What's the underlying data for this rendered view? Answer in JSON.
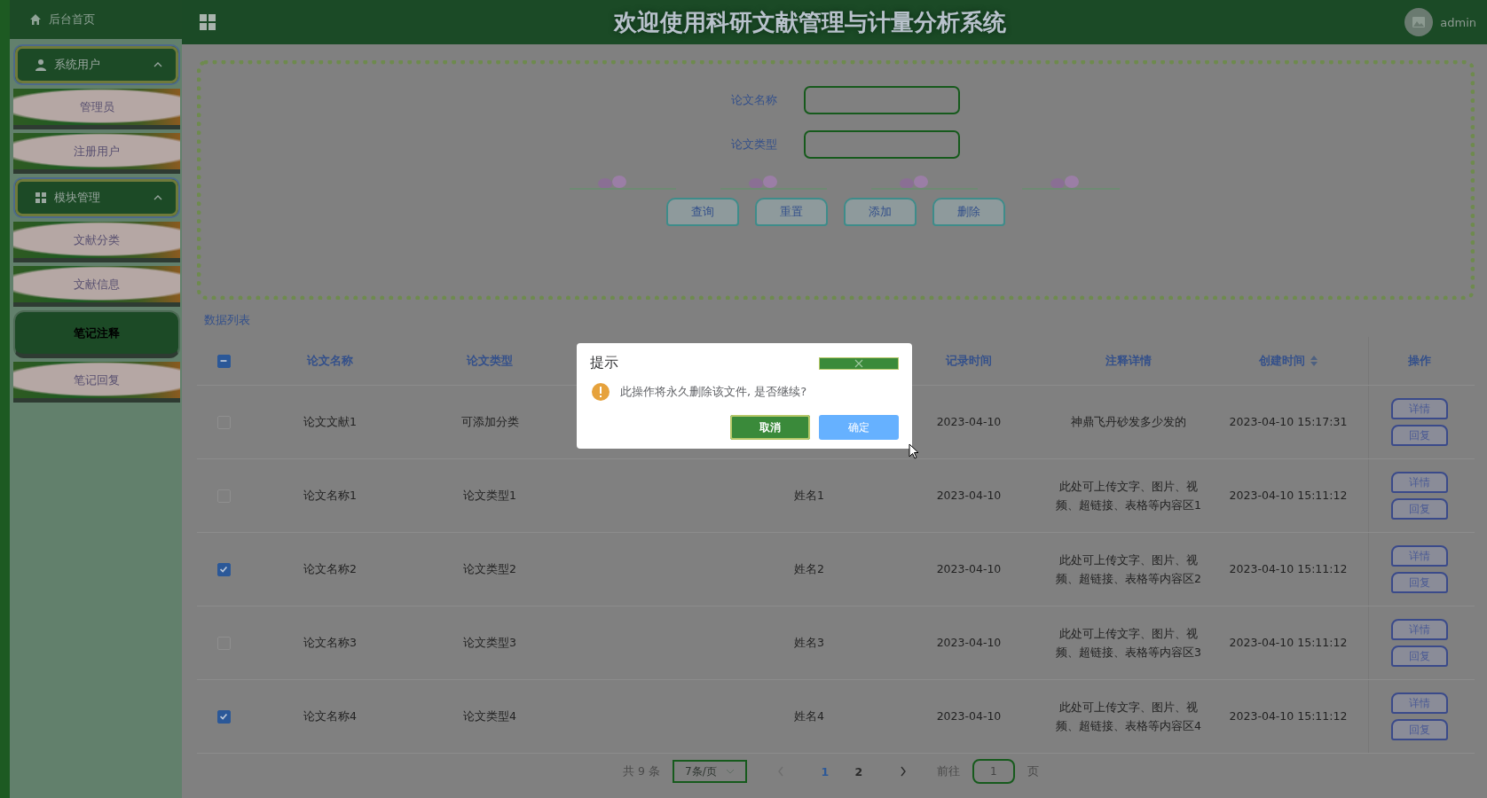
{
  "header": {
    "home": "后台首页",
    "title": "欢迎使用科研文献管理与计量分析系统",
    "user": "admin"
  },
  "sidebar": {
    "groups": [
      {
        "label": "系统用户",
        "expanded": true,
        "items": [
          {
            "label": "管理员",
            "selected": false
          },
          {
            "label": "注册用户",
            "selected": false
          }
        ]
      },
      {
        "label": "模块管理",
        "expanded": true,
        "items": [
          {
            "label": "文献分类",
            "selected": false
          },
          {
            "label": "文献信息",
            "selected": false
          },
          {
            "label": "笔记注释",
            "selected": true
          },
          {
            "label": "笔记回复",
            "selected": false
          }
        ]
      }
    ]
  },
  "search": {
    "fields": [
      {
        "label": "论文名称"
      },
      {
        "label": "论文类型"
      }
    ],
    "buttons": [
      "查询",
      "重置",
      "添加",
      "删除"
    ]
  },
  "list_title": "数据列表",
  "table": {
    "select_all": {
      "partial": true
    },
    "columns": [
      {
        "label": "论文名称"
      },
      {
        "label": "论文类型"
      },
      {},
      {},
      {
        "label": "记录时间"
      },
      {
        "label": "注释详情"
      },
      {
        "label": "创建时间",
        "sortable": true
      }
    ],
    "actions_label": "操作",
    "rows": [
      {
        "checked": false,
        "title": "论文文献1",
        "type": "可添加分类",
        "record_date": "2023-04-10",
        "detail": "神鼎飞丹砂发多少发的",
        "created": "2023-04-10 15:17:31",
        "actions": [
          "详情",
          "回复"
        ]
      },
      {
        "checked": false,
        "title": "论文名称1",
        "type": "论文类型1",
        "column_4": "姓名1",
        "record_date": "2023-04-10",
        "detail": "此处可上传文字、图片、视频、超链接、表格等内容区1",
        "created": "2023-04-10 15:11:12",
        "actions": [
          "详情",
          "回复"
        ]
      },
      {
        "checked": true,
        "title": "论文名称2",
        "type": "论文类型2",
        "column_4": "姓名2",
        "record_date": "2023-04-10",
        "detail": "此处可上传文字、图片、视频、超链接、表格等内容区2",
        "created": "2023-04-10 15:11:12",
        "actions": [
          "详情",
          "回复"
        ]
      },
      {
        "checked": false,
        "title": "论文名称3",
        "type": "论文类型3",
        "column_4": "姓名3",
        "record_date": "2023-04-10",
        "detail": "此处可上传文字、图片、视频、超链接、表格等内容区3",
        "created": "2023-04-10 15:11:12",
        "actions": [
          "详情",
          "回复"
        ]
      },
      {
        "checked": true,
        "title": "论文名称4",
        "type": "论文类型4",
        "column_4": "姓名4",
        "record_date": "2023-04-10",
        "detail": "此处可上传文字、图片、视频、超链接、表格等内容区4",
        "created": "2023-04-10 15:11:12",
        "actions": [
          "详情",
          "回复"
        ]
      }
    ]
  },
  "pagination": {
    "total": "共 9 条",
    "page_size": "7条/页",
    "pages": [
      {
        "label": "1",
        "selected": true
      },
      {
        "label": "2",
        "selected": false
      }
    ],
    "goto_prefix": "前往",
    "goto_value": "1",
    "goto_suffix": "页"
  },
  "dialog": {
    "title": "提示",
    "message": "此操作将永久删除该文件, 是否继续?",
    "buttons": [
      {
        "label": "取消",
        "kind": "cancel"
      },
      {
        "label": "确定",
        "kind": "confirm"
      }
    ]
  }
}
